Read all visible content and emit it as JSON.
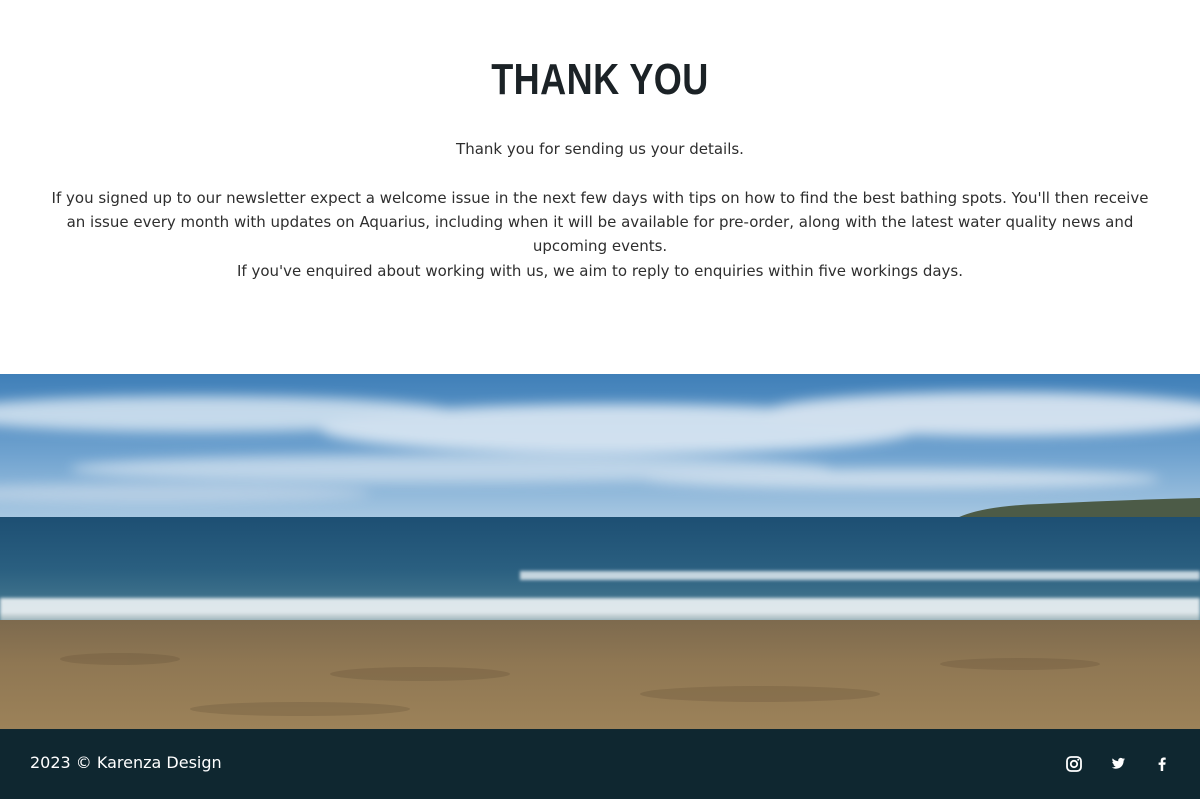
{
  "thank_you": {
    "title": "THANK YOU",
    "line1": "Thank you for sending us your details.",
    "line2": "If you signed up to our newsletter expect a welcome issue in the next few days with tips on how to find the best bathing spots. You'll then receive an issue every month with updates on Aquarius, including when it will be available for pre-order, along with the latest water quality news and upcoming events.",
    "line3": "If you've enquired about working with us, we aim to reply to enquiries within five workings days."
  },
  "footer": {
    "copyright": "2023 © Karenza Design",
    "social_icons": [
      "instagram-icon",
      "twitter-icon",
      "facebook-icon"
    ]
  },
  "colors": {
    "footer_bg": "#0f2730",
    "heading": "#1b2226"
  }
}
